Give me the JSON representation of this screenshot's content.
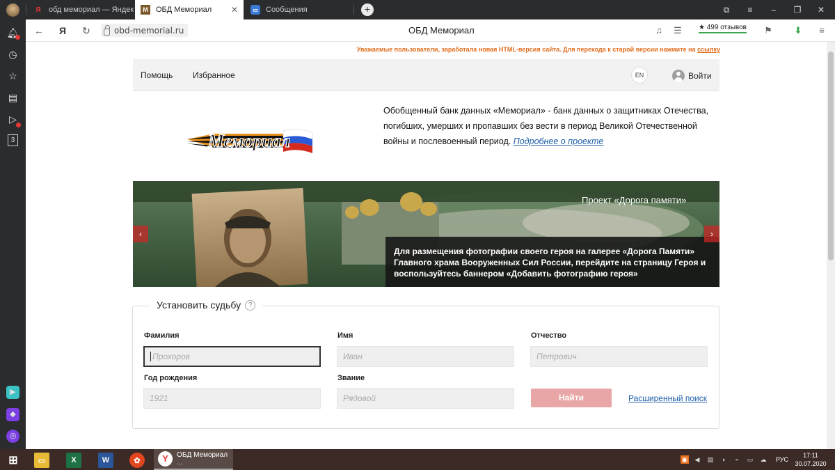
{
  "browser": {
    "tabs": [
      {
        "label": "обд мемориал — Яндекс",
        "favicon": "Я"
      },
      {
        "label": "ОБД Мемориал",
        "favicon": "М"
      },
      {
        "label": "Сообщения",
        "favicon": "msg"
      }
    ],
    "url": "obd-memorial.ru",
    "page_title": "ОБД Мемориал",
    "reviews": "★ 499 отзывов",
    "yandex_logo": "Я",
    "sidebar_badge_number": "3"
  },
  "site": {
    "notice_text": "Уважаемые пользователи, заработала новая HTML-версия сайта. Для перехода к старой версии нажмите на ",
    "notice_link": "ссылку",
    "nav": {
      "help": "Помощь",
      "favorites": "Избранное",
      "lang": "EN",
      "login": "Войти"
    },
    "logo_text": "Мемориал",
    "intro_text": "Обобщенный банк данных «Мемориал» - банк данных о защитниках Отечества, погибших, умерших и пропавших без вести в период Великой Отечественной войны и послевоенный период. ",
    "intro_link": "Подробнее о проекте",
    "banner": {
      "title": "Проект «Дорога памяти»",
      "caption": "Для размещения фотографии своего героя на галерее «Дорога Памяти» Главного храма Вооруженных Сил России, перейдите на страницу Героя и воспользуйтесь баннером «Добавить фотографию героя»",
      "prev": "‹",
      "next": "›"
    },
    "form": {
      "title": "Установить судьбу",
      "help_mark": "?",
      "surname_label": "Фамилия",
      "surname_placeholder": "Прохоров",
      "name_label": "Имя",
      "name_placeholder": "Иван",
      "patronymic_label": "Отчество",
      "patronymic_placeholder": "Петрович",
      "birth_label": "Год рождения",
      "birth_placeholder": "1921",
      "rank_label": "Звание",
      "rank_placeholder": "Рядовой",
      "search_button": "Найти",
      "advanced_link": "Расширенный поиск"
    }
  },
  "taskbar": {
    "active_app": "ОБД Мемориал ...",
    "lang": "РУС",
    "time": "17:11",
    "date": "30.07.2020"
  },
  "colors": {
    "chrome_dark": "#2b2c2e",
    "notice_orange": "#e06c1c",
    "link_blue": "#1f5fa8",
    "search_button": "#e8a6a6",
    "taskbar": "#3b2a26"
  }
}
